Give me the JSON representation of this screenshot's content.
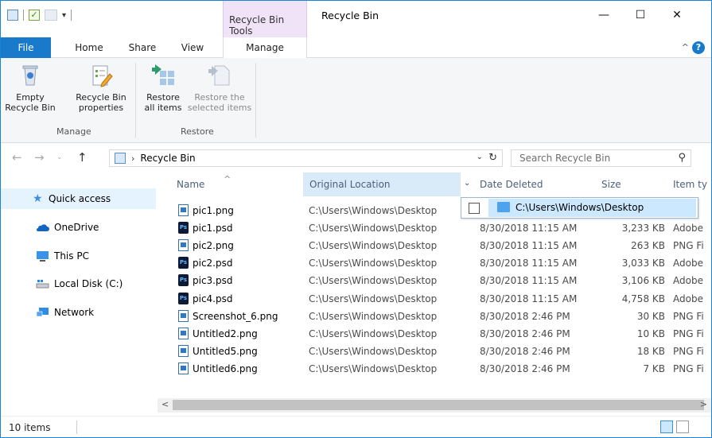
{
  "window": {
    "title": "Recycle Bin",
    "context_tab_group": "Recycle Bin Tools",
    "controls": {
      "minimize": "—",
      "maximize": "☐",
      "close": "✕"
    }
  },
  "tabs": {
    "file": "File",
    "home": "Home",
    "share": "Share",
    "view": "View",
    "manage": "Manage"
  },
  "ribbon": {
    "empty": [
      "Empty",
      "Recycle Bin"
    ],
    "properties": [
      "Recycle Bin",
      "properties"
    ],
    "restore_all": [
      "Restore",
      "all items"
    ],
    "restore_selected": [
      "Restore the",
      "selected items"
    ],
    "group_manage": "Manage",
    "group_restore": "Restore"
  },
  "address": {
    "crumb": "Recycle Bin",
    "search_placeholder": "Search Recycle Bin"
  },
  "nav": {
    "quick_access": "Quick access",
    "onedrive": "OneDrive",
    "this_pc": "This PC",
    "local_disk": "Local Disk (C:)",
    "network": "Network"
  },
  "columns": {
    "name": "Name",
    "original_location": "Original Location",
    "date_deleted": "Date Deleted",
    "size": "Size",
    "item_type": "Item ty"
  },
  "files": [
    {
      "name": "pic1.png",
      "type": "png",
      "location": "C:\\Users\\Windows\\Desktop",
      "date": "",
      "size": "",
      "kind": ""
    },
    {
      "name": "pic1.psd",
      "type": "psd",
      "location": "C:\\Users\\Windows\\Desktop",
      "date": "8/30/2018 11:15 AM",
      "size": "3,233 KB",
      "kind": "Adobe"
    },
    {
      "name": "pic2.png",
      "type": "png",
      "location": "C:\\Users\\Windows\\Desktop",
      "date": "8/30/2018 11:15 AM",
      "size": "263 KB",
      "kind": "PNG Fi"
    },
    {
      "name": "pic2.psd",
      "type": "psd",
      "location": "C:\\Users\\Windows\\Desktop",
      "date": "8/30/2018 11:15 AM",
      "size": "3,033 KB",
      "kind": "Adobe"
    },
    {
      "name": "pic3.psd",
      "type": "psd",
      "location": "C:\\Users\\Windows\\Desktop",
      "date": "8/30/2018 11:15 AM",
      "size": "3,106 KB",
      "kind": "Adobe"
    },
    {
      "name": "pic4.psd",
      "type": "psd",
      "location": "C:\\Users\\Windows\\Desktop",
      "date": "8/30/2018 11:15 AM",
      "size": "4,758 KB",
      "kind": "Adobe"
    },
    {
      "name": "Screenshot_6.png",
      "type": "png",
      "location": "C:\\Users\\Windows\\Desktop",
      "date": "8/30/2018 2:46 PM",
      "size": "30 KB",
      "kind": "PNG Fi"
    },
    {
      "name": "Untitled2.png",
      "type": "png",
      "location": "C:\\Users\\Windows\\Desktop",
      "date": "8/30/2018 2:46 PM",
      "size": "10 KB",
      "kind": "PNG Fi"
    },
    {
      "name": "Untitled5.png",
      "type": "png",
      "location": "C:\\Users\\Windows\\Desktop",
      "date": "8/30/2018 2:46 PM",
      "size": "18 KB",
      "kind": "PNG Fi"
    },
    {
      "name": "Untitled6.png",
      "type": "png",
      "location": "C:\\Users\\Windows\\Desktop",
      "date": "8/30/2018 2:46 PM",
      "size": "7 KB",
      "kind": "PNG Fi"
    }
  ],
  "filter_popup": {
    "value": "C:\\Users\\Windows\\Desktop"
  },
  "status": {
    "count": "10 items"
  },
  "colors": {
    "accent": "#1979ca",
    "context": "#f1e3f7",
    "selection": "#cce8ff"
  }
}
